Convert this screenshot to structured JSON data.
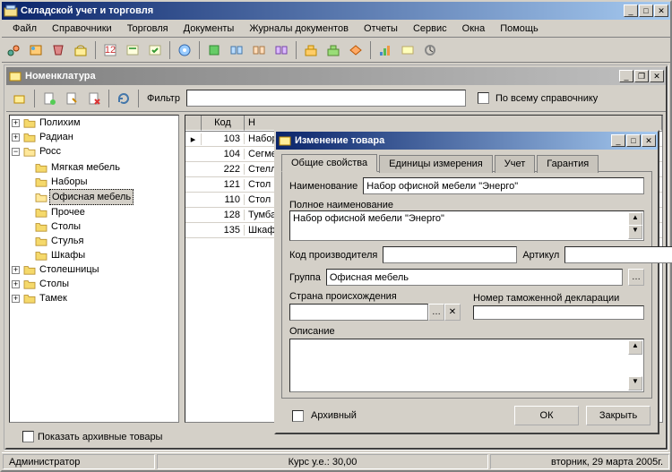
{
  "app": {
    "title": "Складской учет и торговля"
  },
  "menu": [
    "Файл",
    "Справочники",
    "Торговля",
    "Документы",
    "Журналы документов",
    "Отчеты",
    "Сервис",
    "Окна",
    "Помощь"
  ],
  "nomen": {
    "title": "Номенклатура",
    "filter_label": "Фильтр",
    "filter_value": "",
    "global_search_label": "По всему справочнику",
    "show_archive": "Показать архивные товары",
    "tree": {
      "polihim": "Полихим",
      "radian": "Радиан",
      "ross": "Росс",
      "ross_children": [
        "Мягкая мебель",
        "Наборы",
        "Офисная мебель",
        "Прочее",
        "Столы",
        "Стулья",
        "Шкафы"
      ],
      "stoleshnicy": "Столешницы",
      "stoly": "Столы",
      "tamek": "Тамек"
    },
    "grid": {
      "head_code": "Код",
      "head_name": "Н",
      "rows": [
        {
          "code": "103",
          "name": "Набор"
        },
        {
          "code": "104",
          "name": "Сегме"
        },
        {
          "code": "222",
          "name": "Стелл"
        },
        {
          "code": "121",
          "name": "Стол к"
        },
        {
          "code": "110",
          "name": "Стол п"
        },
        {
          "code": "128",
          "name": "Тумба"
        },
        {
          "code": "135",
          "name": "Шкаф"
        }
      ]
    }
  },
  "dlg": {
    "title": "Изменение товара",
    "tabs": [
      "Общие свойства",
      "Единицы измерения",
      "Учет",
      "Гарантия"
    ],
    "name_label": "Наименование",
    "name_value": "Набор офисной мебели \"Энерго\"",
    "fullname_label": "Полное наименование",
    "fullname_value": "Набор офисной мебели \"Энерго\"",
    "mfrcode_label": "Код производителя",
    "mfrcode_value": "",
    "article_label": "Артикул",
    "article_value": "",
    "group_label": "Группа",
    "group_value": "Офисная мебель",
    "country_label": "Страна происхождения",
    "country_value": "",
    "customs_label": "Номер таможенной декларации",
    "customs_value": "",
    "descr_label": "Описание",
    "descr_value": "",
    "archive_label": "Архивный",
    "ok": "ОК",
    "close": "Закрыть"
  },
  "status": {
    "user": "Администратор",
    "rate": "Курс у.е.: 30,00",
    "date": "вторник, 29 марта 2005г."
  }
}
